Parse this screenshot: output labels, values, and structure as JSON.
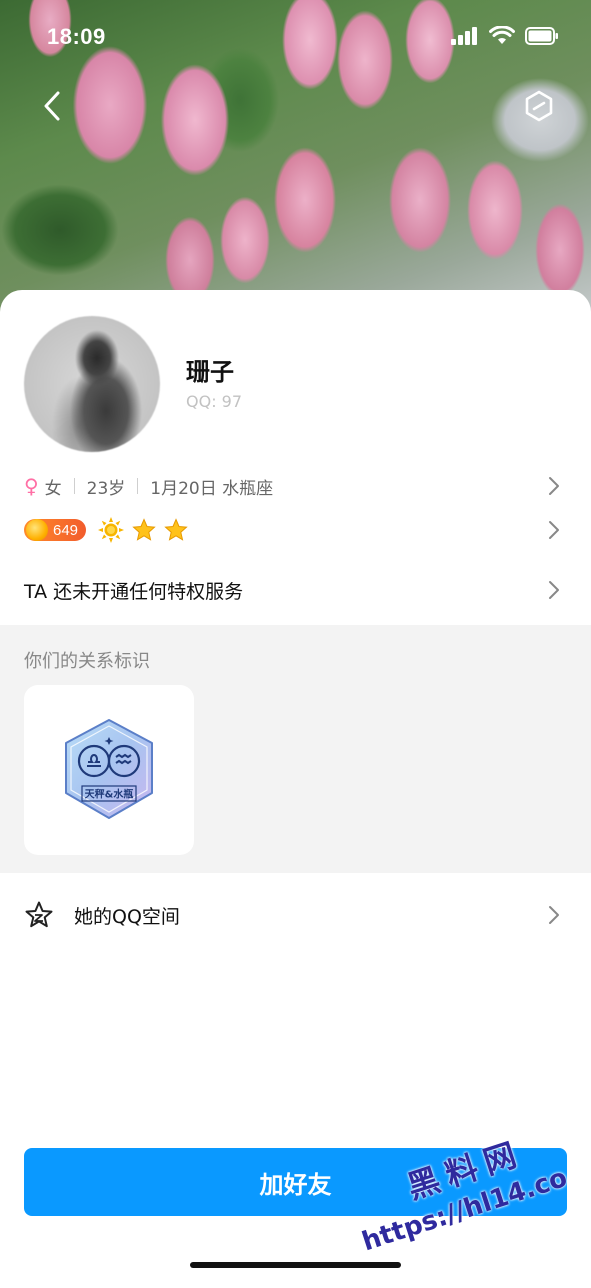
{
  "status_bar": {
    "time": "18:09"
  },
  "profile": {
    "name": "珊子",
    "qq": "QQ:            97",
    "gender": "女",
    "age": "23岁",
    "birthday": "1月20日 水瓶座",
    "level": "649",
    "privilege": "TA 还未开通任何特权服务"
  },
  "relationship": {
    "title": "你们的关系标识",
    "badge_label": "天秤&水瓶"
  },
  "zone": {
    "label": "她的QQ空间"
  },
  "actions": {
    "add_friend": "加好友"
  },
  "watermark": {
    "line1": "黑料网",
    "line2": "https://hl14.co"
  },
  "colors": {
    "primary": "#0a99ff",
    "female": "#ff6fa5",
    "level_badge": "#f25c2c",
    "section_bg": "#f3f3f3"
  }
}
